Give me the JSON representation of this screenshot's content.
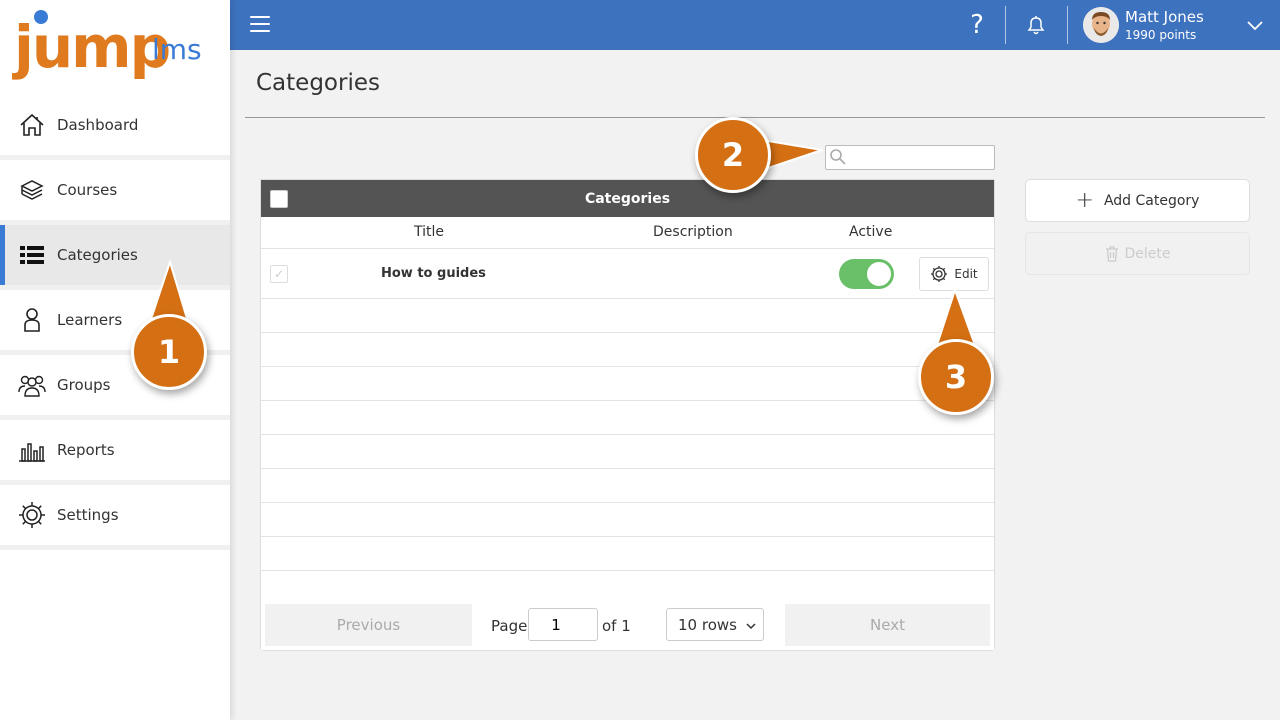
{
  "logo": {
    "primary": "jump",
    "secondary": "lms"
  },
  "sidebar": {
    "items": [
      {
        "label": "Dashboard",
        "icon": "house-icon"
      },
      {
        "label": "Courses",
        "icon": "book-stack-icon"
      },
      {
        "label": "Categories",
        "icon": "list-icon",
        "active": true
      },
      {
        "label": "Learners",
        "icon": "person-icon"
      },
      {
        "label": "Groups",
        "icon": "people-icon"
      },
      {
        "label": "Reports",
        "icon": "bar-chart-icon"
      },
      {
        "label": "Settings",
        "icon": "gear-icon"
      }
    ]
  },
  "topbar": {
    "help_glyph": "?",
    "user": {
      "name": "Matt Jones",
      "points": "1990 points"
    }
  },
  "page": {
    "title": "Categories"
  },
  "search": {
    "placeholder": "",
    "value": ""
  },
  "table": {
    "header": "Categories",
    "columns": {
      "title": "Title",
      "description": "Description",
      "active": "Active"
    },
    "rows": [
      {
        "title": "How to guides",
        "description": "",
        "active": true,
        "edit_label": "Edit"
      }
    ],
    "empty_rows": 9
  },
  "pager": {
    "previous": "Previous",
    "page_label": "Page",
    "page_value": "1",
    "of_label": "of 1",
    "rows_label": "10 rows",
    "next": "Next"
  },
  "actions": {
    "add_label": "Add Category",
    "delete_label": "Delete"
  },
  "callouts": [
    "1",
    "2",
    "3"
  ],
  "colors": {
    "topbar": "#3d72be",
    "brand_orange": "#e07a1f",
    "brand_blue": "#3a7bd5",
    "callout": "#d46f13",
    "toggle_on": "#6abf69",
    "table_header": "#545454"
  }
}
